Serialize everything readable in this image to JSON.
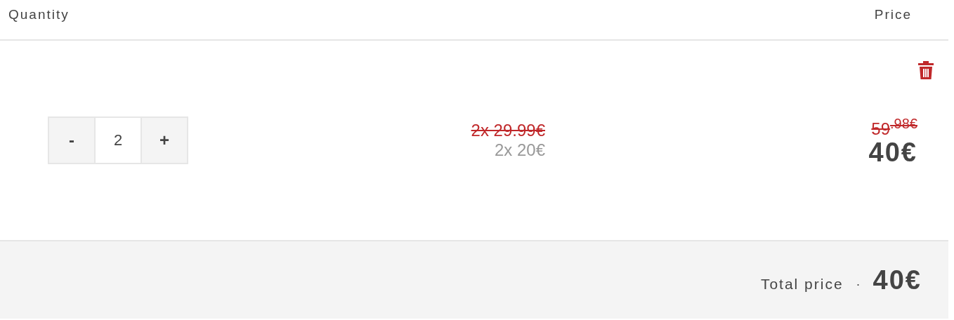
{
  "header": {
    "quantity": "Quantity",
    "price": "Price"
  },
  "item": {
    "quantity": {
      "decrement": "-",
      "value": "2",
      "increment": "+"
    },
    "unit_price_old": "2x 29.99€",
    "unit_price_new": "2x 20€",
    "total_old": "59$^{.98€}$",
    "total_new": "40€"
  },
  "footer": {
    "label": "Total price",
    "separator": "·",
    "total": "40€"
  }
}
